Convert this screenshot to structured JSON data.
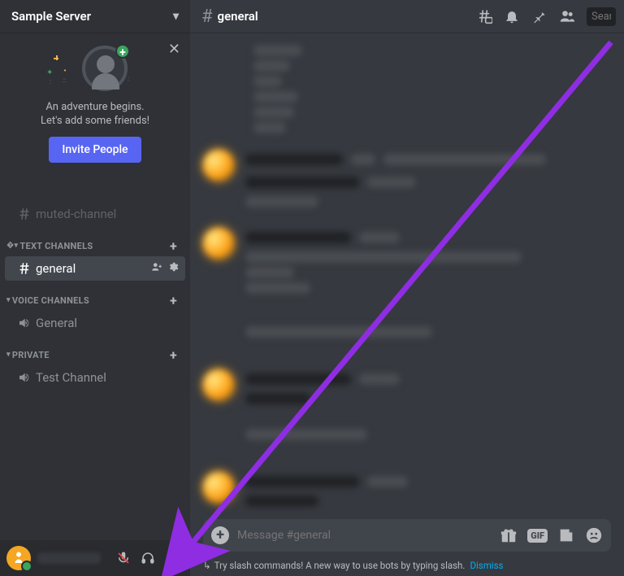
{
  "server": {
    "name": "Sample Server"
  },
  "welcome": {
    "line1": "An adventure begins.",
    "line2": "Let's add some friends!",
    "invite_label": "Invite People"
  },
  "channels": {
    "muted": {
      "name": "muted-channel"
    },
    "categories": [
      {
        "label": "TEXT CHANNELS"
      },
      {
        "label": "VOICE CHANNELS"
      },
      {
        "label": "PRIVATE"
      }
    ],
    "text": {
      "general": "general"
    },
    "voice": {
      "general": "General"
    },
    "private": {
      "test": "Test Channel"
    }
  },
  "chat": {
    "title": "general",
    "search_placeholder": "Sear",
    "input_placeholder": "Message #general"
  },
  "hint": {
    "text": "Try slash commands! A new way to use bots by typing slash.",
    "dismiss": "Dismiss"
  },
  "icons": {
    "gif": "GIF"
  },
  "colors": {
    "accent": "#5865f2",
    "arrow": "#8e2de2"
  }
}
